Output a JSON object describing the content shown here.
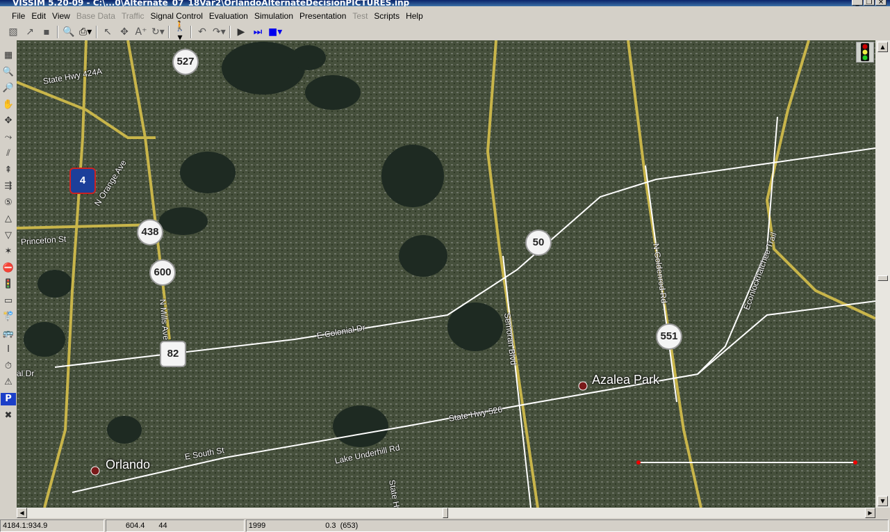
{
  "window": {
    "title": "VISSIM 5.20-09 - C:\\...0\\Alternate_07_18Var2\\OrlandoAlternateDecisionPICTURES.inp"
  },
  "menu": [
    {
      "label": "File",
      "enabled": true
    },
    {
      "label": "Edit",
      "enabled": true
    },
    {
      "label": "View",
      "enabled": true
    },
    {
      "label": "Base Data",
      "enabled": false
    },
    {
      "label": "Traffic",
      "enabled": false
    },
    {
      "label": "Signal Control",
      "enabled": true
    },
    {
      "label": "Evaluation",
      "enabled": true
    },
    {
      "label": "Simulation",
      "enabled": true
    },
    {
      "label": "Presentation",
      "enabled": true
    },
    {
      "label": "Test",
      "enabled": false
    },
    {
      "label": "Scripts",
      "enabled": true
    },
    {
      "label": "Help",
      "enabled": true
    }
  ],
  "toolbar": {
    "icons": [
      "new-network",
      "open",
      "save",
      "print-preview",
      "print",
      "select",
      "rotate",
      "text-size",
      "rotate-view",
      "pedestrian",
      "undo",
      "redo",
      "run-continuous",
      "single-step",
      "stop"
    ]
  },
  "left_toolbar": {
    "icons": [
      "network-display",
      "zoom-in",
      "zoom-out",
      "pan",
      "translate",
      "rotate",
      "links",
      "vehicle-inputs",
      "routing",
      "speed-limit",
      "priority-rule",
      "yield",
      "conflict",
      "stop-sign",
      "signal-head",
      "detector",
      "transit-stop",
      "transit-line",
      "node",
      "travel-time",
      "warning",
      "parking",
      "cross"
    ]
  },
  "map": {
    "shields": [
      "527",
      "4",
      "438",
      "600",
      "50",
      "82",
      "551"
    ],
    "road_labels": [
      "State Hwy 424A",
      "N Orange Ave",
      "Princeton St",
      "N Mills Ave",
      "E Colonial Dr",
      "Semoran Blvd",
      "N Goldenrod Rd",
      "Econlockhatchee Trail",
      "State Hwy 526",
      "E South St",
      "Lake Underhill Rd",
      "State Hwy",
      "al Dr"
    ],
    "places": [
      "Azalea Park",
      "Orlando"
    ]
  },
  "status": {
    "coords": "4184.1:934.9",
    "field2a": "604.4",
    "field2b": "44",
    "field3a": "1999",
    "field3b": "0.3  (653)"
  }
}
